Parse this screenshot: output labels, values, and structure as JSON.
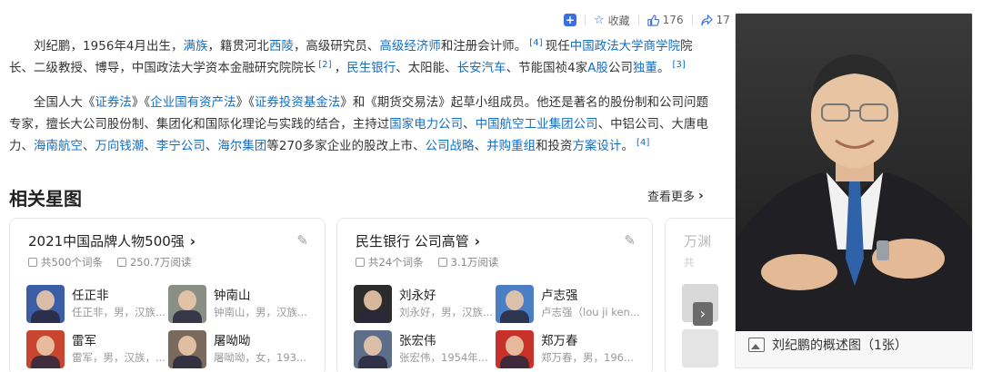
{
  "toolbar": {
    "collect_label": "收藏",
    "like_count": "176",
    "share_count": "17"
  },
  "intro": {
    "p1": [
      {
        "t": "刘纪鹏，1956年4月出生，"
      },
      {
        "t": "满族",
        "link": true
      },
      {
        "t": "，籍贯河北"
      },
      {
        "t": "西陵",
        "link": true
      },
      {
        "t": "，高级研究员、"
      },
      {
        "t": "高级经济师",
        "link": true
      },
      {
        "t": "和注册会计师。"
      },
      {
        "t": "[4]",
        "ref": true
      },
      {
        "t": "现任"
      },
      {
        "t": "中国政法大学商学院",
        "link": true
      },
      {
        "t": "院长、二级教授、博导，中国政法大学资本金融研究院院长"
      },
      {
        "t": "[2]",
        "ref": true
      },
      {
        "t": "，"
      },
      {
        "t": "民生银行",
        "link": true
      },
      {
        "t": "、太阳能、"
      },
      {
        "t": "长安汽车",
        "link": true
      },
      {
        "t": "、节能国祯4家"
      },
      {
        "t": "A股",
        "link": true
      },
      {
        "t": "公司"
      },
      {
        "t": "独董",
        "link": true
      },
      {
        "t": "。"
      },
      {
        "t": "[3]",
        "ref": true
      }
    ],
    "p2": [
      {
        "t": "全国人大《"
      },
      {
        "t": "证券法",
        "link": true
      },
      {
        "t": "》《"
      },
      {
        "t": "企业国有资产法",
        "link": true
      },
      {
        "t": "》《"
      },
      {
        "t": "证券投资基金法",
        "link": true
      },
      {
        "t": "》和《期货交易法》起草小组成员。他还是著名的股份制和公司问题专家，擅长大公司股份制、集团化和国际化理论与实践的结合，主持过"
      },
      {
        "t": "国家电力公司",
        "link": true
      },
      {
        "t": "、"
      },
      {
        "t": "中国航空工业集团公司",
        "link": true
      },
      {
        "t": "、中铝公司、大唐电力、"
      },
      {
        "t": "海南航空",
        "link": true
      },
      {
        "t": "、"
      },
      {
        "t": "万向钱潮",
        "link": true
      },
      {
        "t": "、"
      },
      {
        "t": "李宁公司",
        "link": true
      },
      {
        "t": "、"
      },
      {
        "t": "海尔集团",
        "link": true
      },
      {
        "t": "等270多家企业的股改上市、"
      },
      {
        "t": "公司战略",
        "link": true
      },
      {
        "t": "、"
      },
      {
        "t": "并购重组",
        "link": true
      },
      {
        "t": "和投资"
      },
      {
        "t": "方案设计",
        "link": true
      },
      {
        "t": "。"
      },
      {
        "t": "[4]",
        "ref": true
      }
    ]
  },
  "related": {
    "title": "相关星图",
    "see_more": "查看更多",
    "cards": [
      {
        "title": "2021中国品牌人物500强",
        "meta_count": "共500个词条",
        "meta_reads": "250.7万阅读",
        "people": [
          {
            "name": "任正非",
            "desc": "任正非，男，汉族..."
          },
          {
            "name": "钟南山",
            "desc": "钟南山，男，汉族..."
          },
          {
            "name": "雷军",
            "desc": "雷军，男，汉族，..."
          },
          {
            "name": "屠呦呦",
            "desc": "屠呦呦，女，193..."
          }
        ]
      },
      {
        "title": "民生银行 公司高管",
        "meta_count": "共24个词条",
        "meta_reads": "3.1万阅读",
        "people": [
          {
            "name": "刘永好",
            "desc": "刘永好，男，汉族..."
          },
          {
            "name": "卢志强",
            "desc": "卢志强（lou ji ken..."
          },
          {
            "name": "张宏伟",
            "desc": "张宏伟，1954年..."
          },
          {
            "name": "郑万春",
            "desc": "郑万春，男，196..."
          }
        ]
      },
      {
        "title": "万渊",
        "meta_count": "共"
      }
    ]
  },
  "portrait": {
    "caption": "刘纪鹏的概述图（1张）"
  },
  "colors": {
    "link": "#136ec2",
    "accent": "#3a6fe0"
  }
}
